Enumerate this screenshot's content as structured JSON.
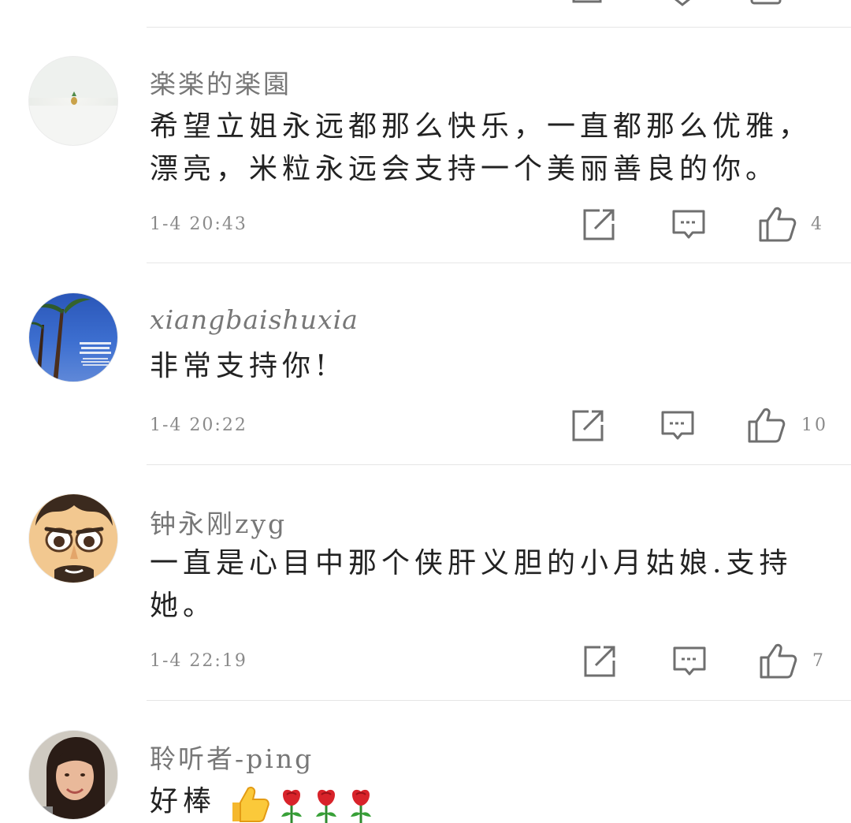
{
  "comments": [
    {
      "username": "楽楽的楽園",
      "text": "希望立姐永远都那么快乐，一直都那么优雅，漂亮，米粒永远会支持一个美丽善良的你。",
      "time": "1-4 20:43",
      "likes": "4",
      "avatar": "pineapple-avatar"
    },
    {
      "username": "xiangbaishuxia",
      "text": "非常支持你!",
      "time": "1-4 20:22",
      "likes": "10",
      "avatar": "palm-tree-avatar"
    },
    {
      "username": "钟永刚zyg",
      "text": "一直是心目中那个侠肝义胆的小月姑娘.支持她。",
      "time": "1-4 22:19",
      "likes": "7",
      "avatar": "cartoon-man-avatar"
    },
    {
      "username": "聆听者-ping",
      "text": "好棒",
      "time": "",
      "likes": "",
      "avatar": "woman-photo-avatar"
    }
  ],
  "icons": {
    "share": "share-icon",
    "reply": "reply-icon",
    "like": "thumbs-up-icon",
    "thumb_emoji": "thumbs-up-emoji",
    "rose_emoji": "rose-emoji"
  },
  "colors": {
    "text": "#222222",
    "meta": "#8a8a8a",
    "icon": "#6f6f6f",
    "divider": "#e6e6e6"
  }
}
